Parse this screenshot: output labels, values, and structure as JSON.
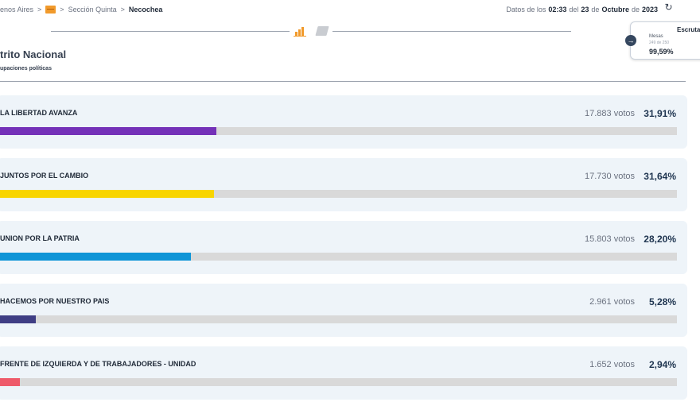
{
  "breadcrumb": {
    "province": "enos Aires",
    "section": "Sección Quinta",
    "current": "Necochea"
  },
  "timestamp": {
    "prefix": "Datos de los",
    "time": "02:33",
    "connector_del": "del",
    "day": "23",
    "connector_de": "de",
    "month": "Octubre",
    "connector_de2": "de",
    "year": "2023"
  },
  "escrutado": {
    "title": "Escrutad",
    "mesas_label": "Mesas",
    "mesas_count": "249 de 250",
    "percent": "99,59%"
  },
  "page": {
    "title": "trito Nacional",
    "subtitle": "upaciones políticas"
  },
  "icons": {
    "breadcrumb_flag": "flag-icon",
    "refresh": "refresh-icon",
    "chart": "bar-chart-icon",
    "map": "map-icon",
    "arrow": "arrow-right-icon"
  },
  "parties": [
    {
      "name": "LA LIBERTAD AVANZA",
      "votes": "17.883 votos",
      "percent": "31,91%",
      "share": 31.91,
      "color": "#7431b8"
    },
    {
      "name": "JUNTOS POR EL CAMBIO",
      "votes": "17.730 votos",
      "percent": "31,64%",
      "share": 31.64,
      "color": "#f8d500"
    },
    {
      "name": "UNION POR LA PATRIA",
      "votes": "15.803 votos",
      "percent": "28,20%",
      "share": 28.2,
      "color": "#0f95d7"
    },
    {
      "name": "HACEMOS POR NUESTRO PAIS",
      "votes": "2.961 votos",
      "percent": "5,28%",
      "share": 5.28,
      "color": "#3f3e84"
    },
    {
      "name": "FRENTE DE IZQUIERDA Y DE TRABAJADORES - UNIDAD",
      "votes": "1.652 votos",
      "percent": "2,94%",
      "share": 2.94,
      "color": "#ee5a6a"
    }
  ]
}
